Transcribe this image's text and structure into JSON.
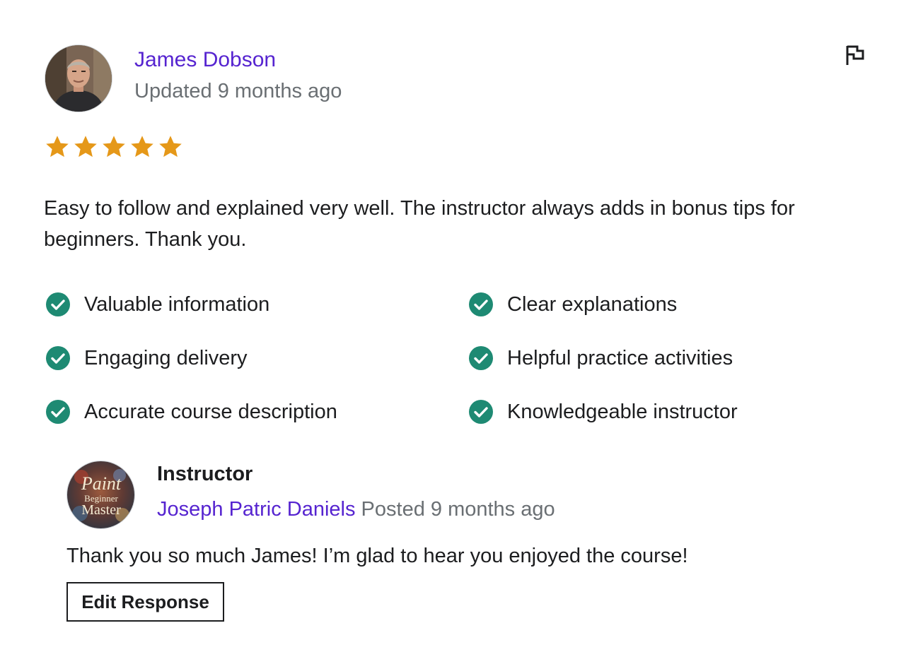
{
  "review": {
    "reviewer_name": "James Dobson",
    "updated": "Updated 9 months ago",
    "rating": 5,
    "max_rating": 5,
    "text": "Easy to follow and explained very well. The instructor always adds in bonus tips for beginners. Thank you.",
    "tags": [
      "Valuable information",
      "Clear explanations",
      "Engaging delivery",
      "Helpful practice activities",
      "Accurate course description",
      "Knowledgeable instructor"
    ]
  },
  "response": {
    "title": "Instructor",
    "author": "Joseph Patric Daniels",
    "posted": "Posted 9 months ago",
    "text": "Thank you so much James! I’m glad to hear you enjoyed the course!",
    "edit_label": "Edit Response",
    "avatar_logo_lines": [
      "Paint",
      "Beginner",
      "Master"
    ]
  },
  "colors": {
    "link": "#5624d0",
    "muted": "#6a6f73",
    "star": "#e59819",
    "check": "#1e8a73",
    "text": "#1c1d1f"
  },
  "icons": {
    "report": "flag-icon",
    "star": "star-icon",
    "tag": "check-circle-icon"
  }
}
